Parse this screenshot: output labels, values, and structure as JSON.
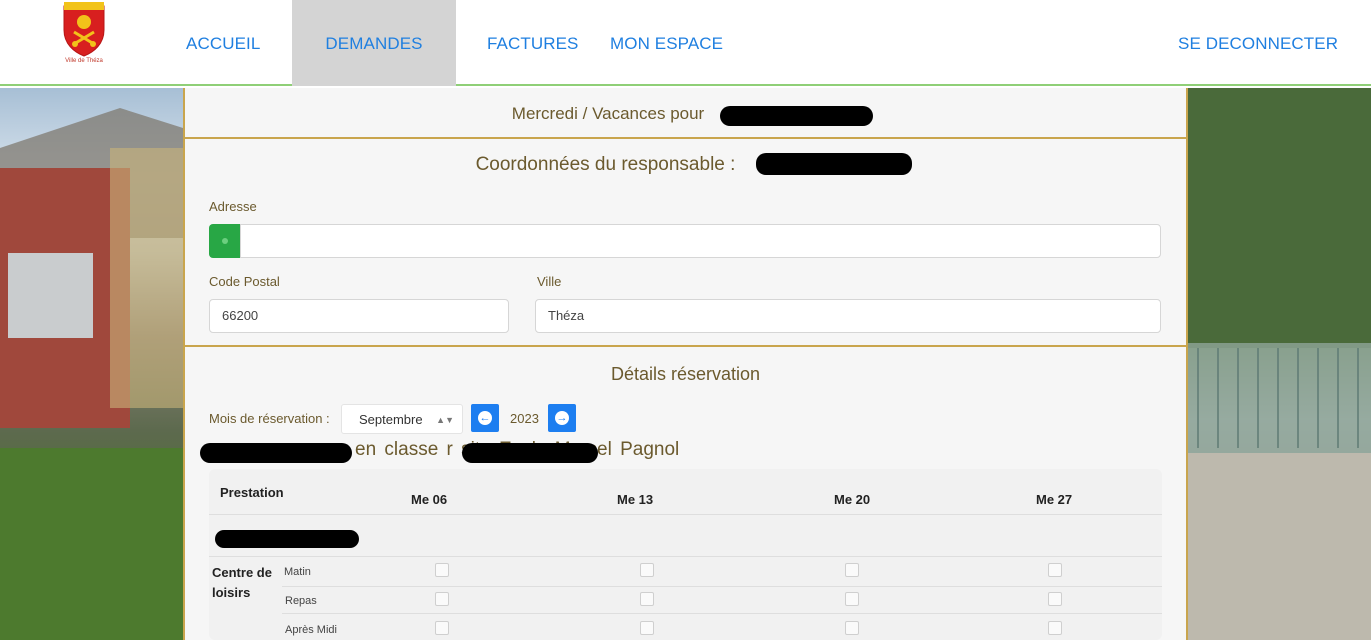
{
  "logo": {
    "caption": "Ville de Théza",
    "icon": "coat-of-arms-icon"
  },
  "nav": {
    "accueil": "ACCUEIL",
    "demandes": "DEMANDES",
    "factures": "FACTURES",
    "espace": "MON ESPACE",
    "logout": "SE DECONNECTER"
  },
  "header": {
    "title": "Mercredi / Vacances pour"
  },
  "responsable": {
    "title": "Coordonnées du responsable :",
    "adresse_label": "Adresse",
    "code_postal_label": "Code Postal",
    "code_postal_value": "66200",
    "ville_label": "Ville",
    "ville_value": "Théza"
  },
  "reservation": {
    "title": "Détails réservation",
    "mois_label": "Mois de réservation :",
    "mois_value": "Septembre",
    "year": "2023",
    "child_line": "en classe r site Ecole Marcel Pagnol"
  },
  "table": {
    "header_prestation": "Prestation",
    "columns": [
      "Me 06",
      "Me 13",
      "Me 20",
      "Me 27"
    ],
    "group_label_1": "Centre de",
    "group_label_2": "loisirs",
    "rows": [
      "Matin",
      "Repas",
      "Après Midi"
    ]
  },
  "colors": {
    "accent": "#1f7fe0",
    "border": "#c9a54d",
    "active_tab": "#d4d4d4",
    "addon": "#28a745"
  }
}
